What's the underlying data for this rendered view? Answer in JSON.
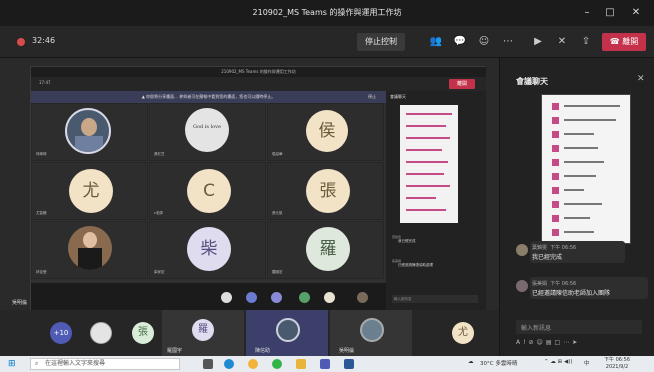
{
  "window": {
    "title": "210902_MS Teams 的操作與運用工作坊",
    "controls": [
      "–",
      "□",
      "✕"
    ]
  },
  "toolbar": {
    "timer": "32:46",
    "stop_share_label": "停止控制",
    "leave_label": "離開",
    "icons": [
      "people-icon",
      "chat-icon",
      "reactions-icon",
      "more-icon",
      "camera-icon",
      "mic-off-icon",
      "share-icon"
    ]
  },
  "shared": {
    "titlebar": "210902_MS Teams 的操作與運用工作坊",
    "timer": "17:47",
    "leave_label": "離開",
    "banner": "▲ 你即將分享畫面... 參與者可在簡報中看到您的畫面，您也可以隨時停止。",
    "banner_button": "停止",
    "tiles": [
      {
        "name": "林綺琦",
        "kind": "photo"
      },
      {
        "name": "張紅豆",
        "kind": "logo",
        "logo_text": "God is love"
      },
      {
        "name": "侯紹華",
        "kind": "letter",
        "letter": "侯"
      },
      {
        "name": "尤智麒",
        "kind": "letter",
        "letter": "尤"
      },
      {
        "name": "c老師",
        "kind": "letter",
        "letter": "C"
      },
      {
        "name": "張元凱",
        "kind": "letter",
        "letter": "張"
      },
      {
        "name": "林佳瑩",
        "kind": "photo"
      },
      {
        "name": "柴家宏",
        "kind": "letter",
        "letter": "柴"
      },
      {
        "name": "羅國宏",
        "kind": "letter",
        "letter": "羅"
      }
    ],
    "chat_title": "會議聊天",
    "chat_messages": [
      {
        "author": "葉錦雯",
        "text": "我已經完成"
      },
      {
        "author": "張美娟",
        "text": "已經邀請陳張協助處理"
      }
    ],
    "compose_placeholder": "輸入新訊息"
  },
  "strip": {
    "overflow_count": "+10",
    "names": [
      "羅國宇",
      "陳信助",
      "吳明倫"
    ],
    "presenter": "吳明倫"
  },
  "chat": {
    "title": "會議聊天",
    "messages": [
      {
        "author": "葉錦雯",
        "time": "下午 06:56",
        "text": "我已經完成"
      },
      {
        "author": "張美娟",
        "time": "下午 06:56",
        "text": "已經邀請陳信助老師加入團隊"
      }
    ],
    "compose_placeholder": "輸入新訊息"
  },
  "taskbar": {
    "search_placeholder": "在這裡輸入文字來搜尋",
    "weather": "30°C 多雲時晴",
    "ime": "中",
    "clock_time": "下午 06:56",
    "clock_date": "2021/9/2"
  }
}
